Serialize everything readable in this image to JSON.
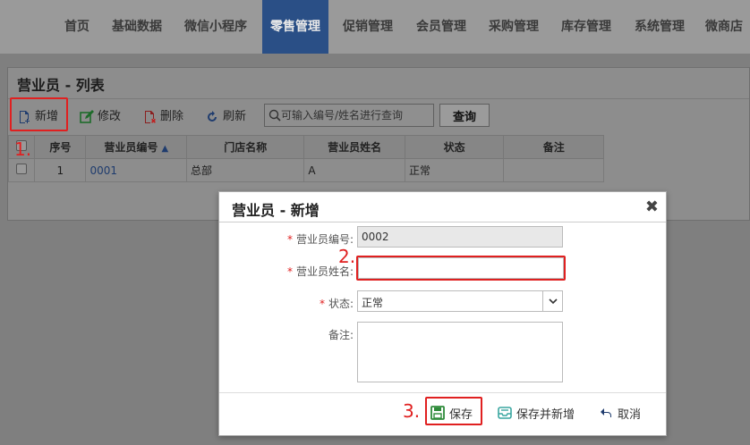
{
  "nav": {
    "items": [
      "首页",
      "基础数据",
      "微信小程序",
      "零售管理",
      "促销管理",
      "会员管理",
      "采购管理",
      "库存管理",
      "系统管理",
      "微商店"
    ],
    "active_index": 3
  },
  "list": {
    "title": "营业员 - 列表",
    "toolbar": {
      "add": "新增",
      "edit": "修改",
      "delete": "删除",
      "refresh": "刷新",
      "search_placeholder": "可输入编号/姓名进行查询",
      "query": "查询"
    },
    "columns": [
      "序号",
      "营业员编号",
      "门店名称",
      "营业员姓名",
      "状态",
      "备注"
    ],
    "sort_indicator": "▲",
    "rows": [
      {
        "index": "1",
        "code": "0001",
        "store": "总部",
        "name": "A",
        "status": "正常",
        "remark": ""
      }
    ]
  },
  "annotations": {
    "step1": "1.",
    "step2": "2.",
    "step3": "3."
  },
  "dialog": {
    "title": "营业员 - 新增",
    "close": "✖",
    "fields": {
      "code_label": "营业员编号:",
      "code_value": "0002",
      "name_label": "营业员姓名:",
      "name_value": "",
      "status_label": "状态:",
      "status_value": "正常",
      "remark_label": "备注:"
    },
    "buttons": {
      "save": "保存",
      "save_new": "保存并新增",
      "cancel": "取消"
    }
  },
  "colors": {
    "nav_active": "#2a4f86",
    "highlight_red": "#e02020",
    "save_green": "#2e8b3a",
    "teal": "#3aa6a0",
    "link_blue": "#1f3c6e"
  }
}
